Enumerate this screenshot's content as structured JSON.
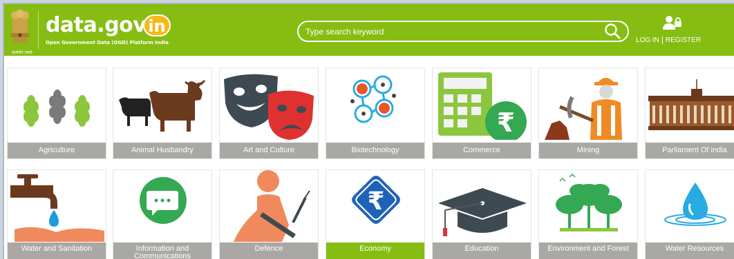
{
  "header": {
    "emblem_caption": "सत्यमेव जयते",
    "logo_text": "data.gov",
    "logo_badge": "in",
    "logo_subtitle": "Open Government Data (OGD) Platform India",
    "search_placeholder": "Type search keyword",
    "login_label": "LOG IN",
    "register_label": "REGISTER",
    "search_icon": "search-icon",
    "login_icon": "user-lock-icon"
  },
  "colors": {
    "brand_green": "#86bd12",
    "tile_label_gray": "#a9a8a4",
    "badge_yellow": "#f5b918"
  },
  "sectors": [
    {
      "label": "Agriculture",
      "icon": "wheat-icon"
    },
    {
      "label": "Animal Husbandry",
      "icon": "cattle-icon"
    },
    {
      "label": "Art and Culture",
      "icon": "theatre-masks-icon"
    },
    {
      "label": "Biotechnology",
      "icon": "molecule-icon"
    },
    {
      "label": "Commerce",
      "icon": "calculator-rupee-icon"
    },
    {
      "label": "Mining",
      "icon": "miner-icon"
    },
    {
      "label": "Parliament Of india",
      "icon": "parliament-icon"
    },
    {
      "label": "Water and Sanitation",
      "icon": "tap-water-icon"
    },
    {
      "label": "Information and Communications",
      "icon": "chat-bubble-icon"
    },
    {
      "label": "Defence",
      "icon": "soldier-icon"
    },
    {
      "label": "Economy",
      "icon": "rupee-diamond-icon"
    },
    {
      "label": "Education",
      "icon": "graduation-cap-icon"
    },
    {
      "label": "Environment and Forest",
      "icon": "forest-icon"
    },
    {
      "label": "Water Resources",
      "icon": "water-drop-icon"
    }
  ],
  "active_sector": "Economy"
}
